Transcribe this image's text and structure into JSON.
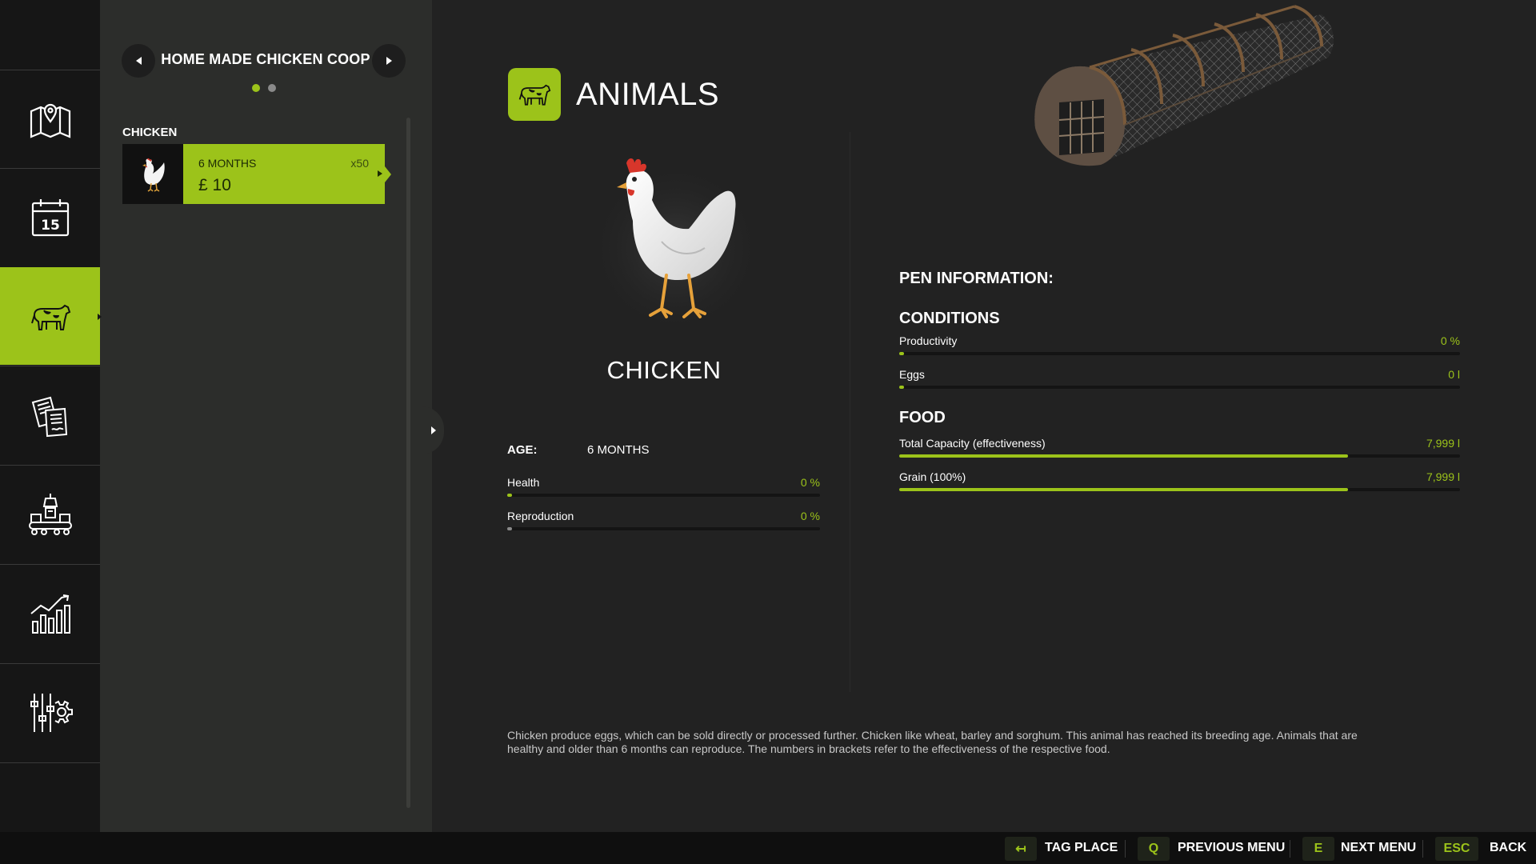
{
  "nav": {
    "items": [
      {
        "name": "map",
        "icon": "map-pin-icon"
      },
      {
        "name": "calendar",
        "icon": "calendar-icon",
        "day": "15"
      },
      {
        "name": "animals",
        "icon": "cow-icon",
        "active": true
      },
      {
        "name": "contracts",
        "icon": "documents-icon"
      },
      {
        "name": "production",
        "icon": "factory-conveyor-icon"
      },
      {
        "name": "statistics",
        "icon": "bar-chart-icon"
      },
      {
        "name": "settings",
        "icon": "sliders-gear-icon"
      }
    ]
  },
  "list": {
    "title": "HOME MADE CHICKEN COOP",
    "page_count": 2,
    "active_page": 1,
    "category": "CHICKEN",
    "cards": [
      {
        "age": "6 MONTHS",
        "count": "x50",
        "price": "£ 10",
        "icon": "chicken-icon"
      }
    ]
  },
  "header": {
    "title": "ANIMALS",
    "icon": "cow-icon"
  },
  "animal": {
    "name": "CHICKEN",
    "age_label": "AGE:",
    "age_value": "6 MONTHS",
    "stats": [
      {
        "label": "Health",
        "value": "0 %",
        "fill": 0.0
      },
      {
        "label": "Reproduction",
        "value": "0 %",
        "fill": 0.0
      }
    ]
  },
  "pen": {
    "title": "PEN INFORMATION:",
    "conditions_title": "CONDITIONS",
    "conditions": [
      {
        "label": "Productivity",
        "value": "0 %",
        "fill": 0.0
      },
      {
        "label": "Eggs",
        "value": "0 l",
        "fill": 0.0
      }
    ],
    "food_title": "FOOD",
    "food": [
      {
        "label": "Total Capacity (effectiveness)",
        "value": "7,999 l",
        "fill": 0.8
      },
      {
        "label": "Grain (100%)",
        "value": "7,999 l",
        "fill": 0.8
      }
    ]
  },
  "description": "Chicken produce eggs, which can be sold directly or processed further. Chicken like wheat, barley and sorghum. This animal has reached its breeding age. Animals that are healthy and older than 6 months can reproduce. The numbers in brackets refer to the effectiveness of the respective food.",
  "hints": [
    {
      "key": "↤",
      "label": "TAG PLACE"
    },
    {
      "key": "Q",
      "label": "PREVIOUS MENU"
    },
    {
      "key": "E",
      "label": "NEXT MENU"
    },
    {
      "key": "ESC",
      "label": "BACK"
    }
  ],
  "colors": {
    "accent": "#9cc31a",
    "background": "#222222",
    "panel": "#2c2d2b",
    "nav": "#161616"
  }
}
